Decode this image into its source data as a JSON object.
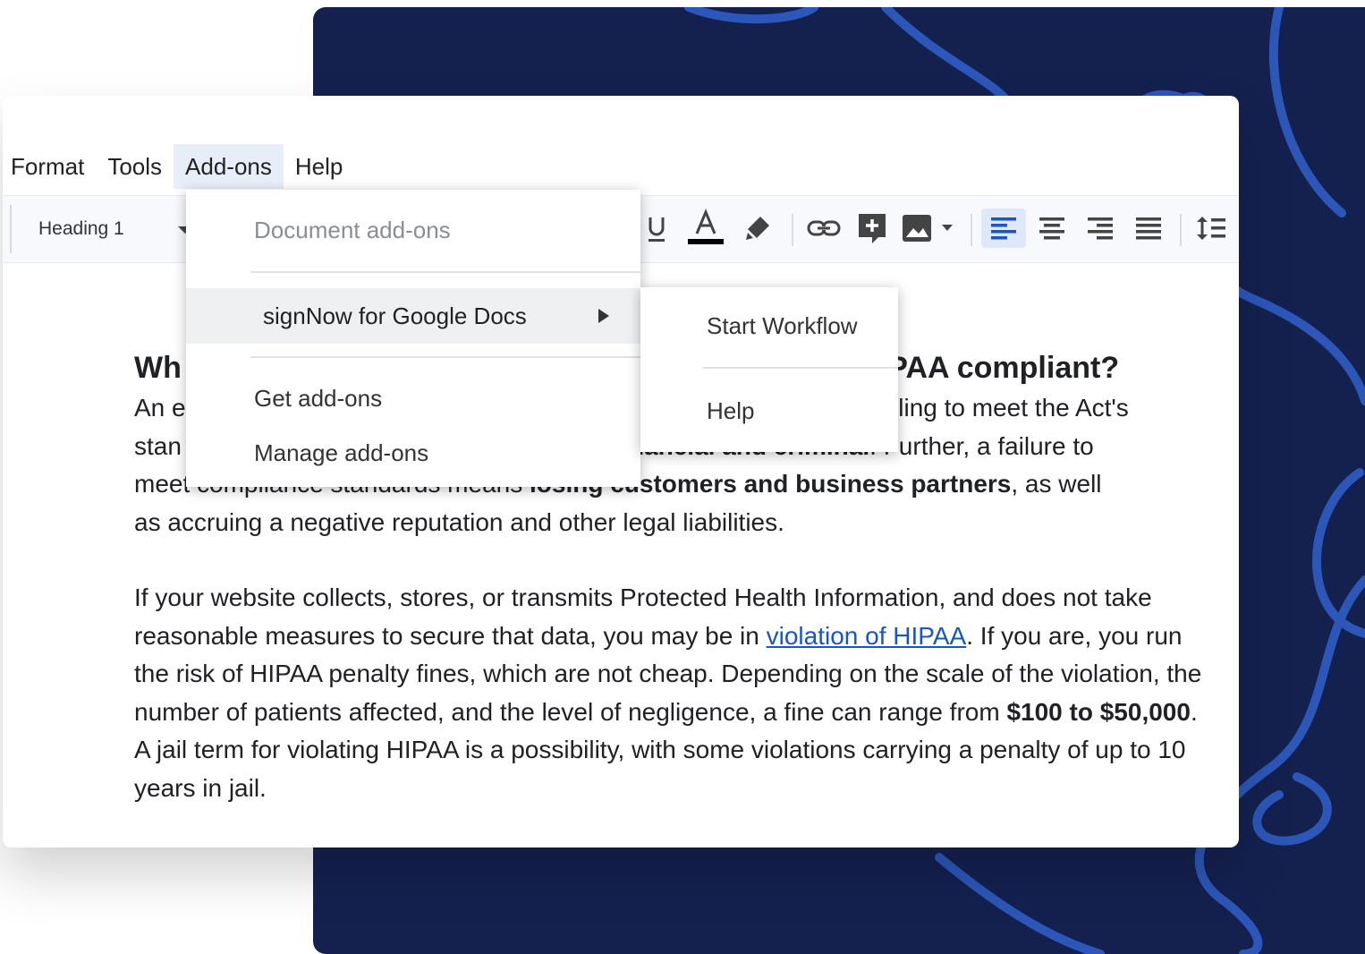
{
  "menubar": {
    "items": [
      {
        "label": "Format"
      },
      {
        "label": "Tools"
      },
      {
        "label": "Add-ons",
        "active": true
      },
      {
        "label": "Help"
      }
    ]
  },
  "toolbar": {
    "paragraph_style": "Heading 1",
    "icons": [
      "underline-icon",
      "text-color-icon",
      "highlight-icon",
      "link-icon",
      "add-comment-icon",
      "insert-image-icon",
      "align-left-icon",
      "align-center-icon",
      "align-right-icon",
      "justify-icon",
      "line-spacing-icon"
    ],
    "text_color_underline": "#000000",
    "active_alignment": "left"
  },
  "dropdown": {
    "header": "Document add-ons",
    "addon_item": "signNow for Google Docs",
    "get_addons": "Get add-ons",
    "manage_addons": "Manage add-ons"
  },
  "submenu": {
    "start_workflow": "Start Workflow",
    "help": "Help"
  },
  "document": {
    "heading_start": "Wh",
    "heading_end": "IPAA compliant?",
    "p1_line1_start": "An e",
    "p1_line1_end": "r failing to meet the Act's",
    "p1_line2_start": "stan",
    "p1_line2_bold": "nancial and criminal",
    "p1_line2_end": ". Further, a failure to",
    "p1_line3_start": "meet compliance standards means ",
    "p1_line3_bold": "losing customers and business partners",
    "p1_line3_end": ", as well",
    "p1_line4": "as accruing a negative reputation and other legal liabilities.",
    "p2_part1": "If your website collects, stores, or transmits Protected Health Information, and does not take reasonable measures to secure that data, you may be in ",
    "p2_link": "violation of HIPAA",
    "p2_part2": ". If you are, you run the risk of HIPAA penalty fines, which are not cheap. Depending on the scale of the violation, the number of patients affected, and the level of negligence, a fine can range from ",
    "p2_bold": "$100 to $50,000",
    "p2_part3": ". A jail term for violating HIPAA is a possibility, with some violations carrying a penalty of up to 10 years in jail."
  },
  "colors": {
    "background_panel": "#14214f",
    "swirl": "#2f5cc4",
    "link": "#1a55c5",
    "menu_active_bg": "#e8eef9"
  }
}
